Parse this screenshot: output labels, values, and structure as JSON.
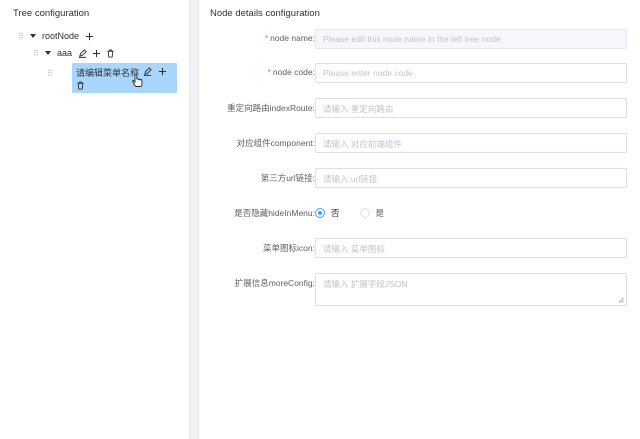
{
  "tree_panel": {
    "title": "Tree configuration",
    "nodes": [
      {
        "label": "rootNode"
      },
      {
        "label": "aaa"
      },
      {
        "label": "请编辑菜单名称"
      }
    ]
  },
  "form_panel": {
    "title": "Node details configuration",
    "fields": {
      "node_name": {
        "label": "node name:",
        "placeholder": "Please edit this node name in the left tree node"
      },
      "node_code": {
        "label": "node code:",
        "placeholder": "Please enter node code"
      },
      "index_route": {
        "label": "重定向路由indexRoute:",
        "placeholder": "请输入 重定向路由"
      },
      "component": {
        "label": "对应组件component:",
        "placeholder": "请输入 对应前端组件"
      },
      "url": {
        "label": "第三方url链接:",
        "placeholder": "请输入 url链接"
      },
      "hide_in_menu": {
        "label": "是否隐藏hideInMenu:",
        "option_no": "否",
        "option_yes": "是",
        "selected": "否"
      },
      "icon": {
        "label": "菜单图标icon:",
        "placeholder": "请输入 菜单图标"
      },
      "more_config": {
        "label": "扩展信息moreConfig:",
        "placeholder": "请输入 扩展字段JSON"
      }
    },
    "required_mark": "*"
  },
  "colors": {
    "accent": "#409eff",
    "selected_node_bg": "#a9d6ff",
    "required": "#f56c6c"
  }
}
